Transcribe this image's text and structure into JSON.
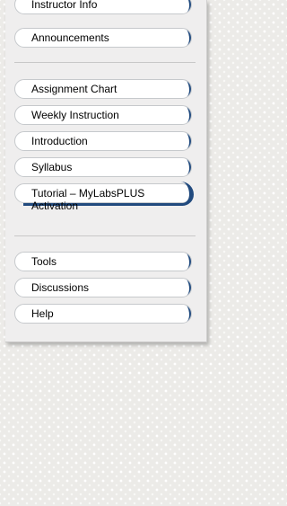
{
  "menu": {
    "group1": [
      {
        "label": "Instructor Info"
      },
      {
        "label": "Announcements"
      }
    ],
    "group2": [
      {
        "label": "Assignment Chart"
      },
      {
        "label": "Weekly Instruction"
      },
      {
        "label": "Introduction"
      },
      {
        "label": "Syllabus"
      },
      {
        "label": "Tutorial – MyLabsPLUS Activation"
      }
    ],
    "group3": [
      {
        "label": "Tools"
      },
      {
        "label": "Discussions"
      },
      {
        "label": "Help"
      }
    ]
  },
  "colors": {
    "accent_swoosh": "#214a7e",
    "panel_background": "#efeeee",
    "button_background": "#ffffff"
  }
}
